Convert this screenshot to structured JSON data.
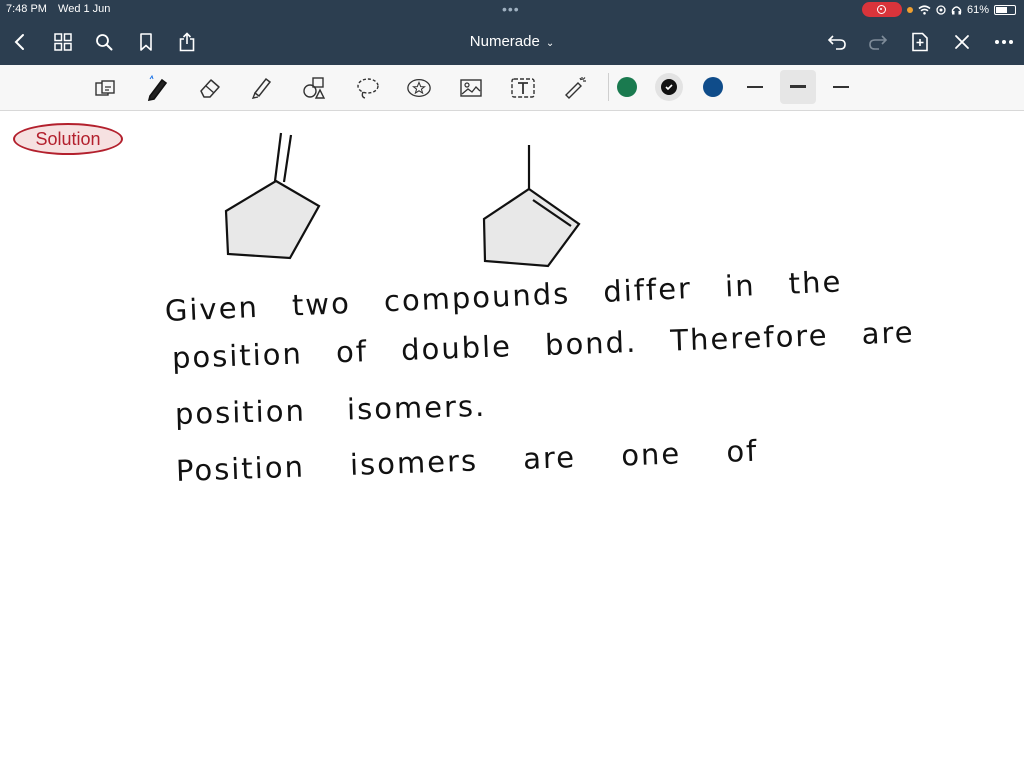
{
  "status_bar": {
    "time": "7:48 PM",
    "date": "Wed 1 Jun",
    "battery_text": "61%",
    "battery_level": 0.61
  },
  "nav": {
    "title": "Numerade"
  },
  "toolbar": {
    "colors": [
      "#1a7a4f",
      "#111111",
      "#0f4c8a"
    ],
    "accent": "#2c3e50"
  },
  "canvas": {
    "label": "Solution",
    "lines": [
      "Given  two  compounds  differ  in  the",
      "position  of  double  bond.  Therefore  are",
      "position  isomers.",
      "Position  isomers  are  one  of"
    ]
  }
}
